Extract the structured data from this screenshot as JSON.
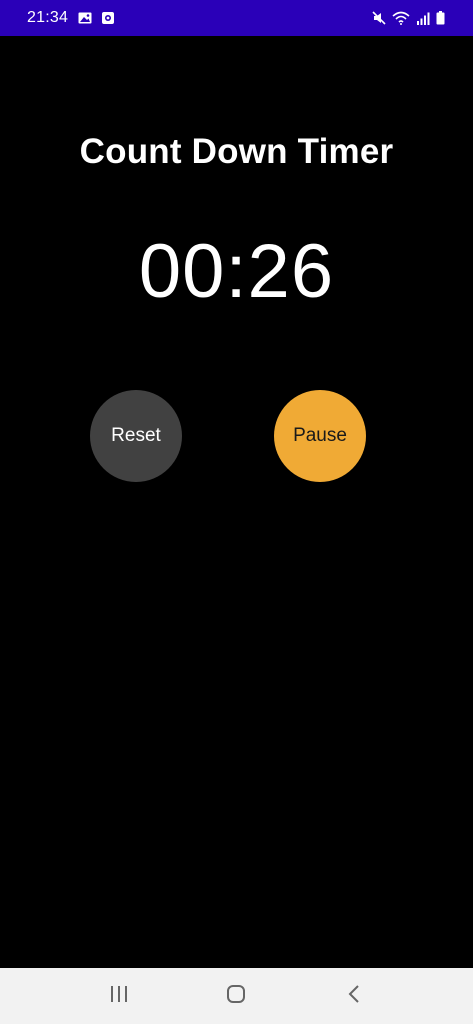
{
  "status_bar": {
    "time": "21:34",
    "icons": [
      "image-icon",
      "screen-record-icon",
      "mute-icon",
      "wifi-icon",
      "signal-icon",
      "battery-icon"
    ],
    "background": "#2a00b8"
  },
  "app": {
    "title": "Count Down Timer",
    "timer": "00:26",
    "background": "#000000"
  },
  "buttons": {
    "reset_label": "Reset",
    "reset_color": "#414141",
    "pause_label": "Pause",
    "pause_color": "#f0aa35"
  },
  "nav_bar": {
    "items": [
      "recent-apps-icon",
      "home-icon",
      "back-icon"
    ],
    "background": "#f2f2f2"
  }
}
